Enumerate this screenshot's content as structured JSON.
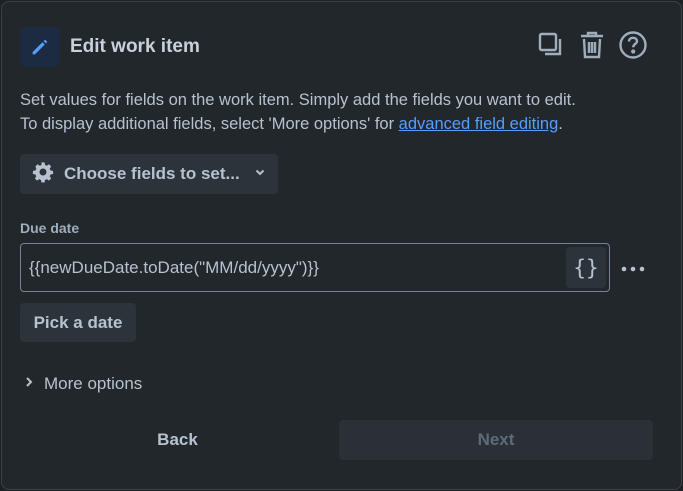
{
  "header": {
    "title": "Edit work item",
    "icons": [
      "pencil-icon",
      "duplicate-icon",
      "trash-icon",
      "help-icon"
    ]
  },
  "description": {
    "line1": "Set values for fields on the work item. Simply add the fields you want to edit.",
    "line2_prefix": "To display additional fields, select 'More options' for ",
    "link": "advanced field editing",
    "line2_suffix": "."
  },
  "choose_fields": {
    "label": "Choose fields to set...",
    "icon": "gear-icon"
  },
  "due_date": {
    "label": "Due date",
    "value": "{{newDueDate.toDate(\"MM/dd/yyyy\")}}",
    "smart_value_button": "{}",
    "pick_date_label": "Pick a date"
  },
  "more_options": {
    "label": "More options"
  },
  "footer": {
    "back_label": "Back",
    "next_label": "Next"
  },
  "colors": {
    "panel_bg": "#22272b",
    "link": "#579dff",
    "accent_icon": "#579dff",
    "text": "#b6c2cf",
    "disabled_text": "#5e6b78"
  }
}
